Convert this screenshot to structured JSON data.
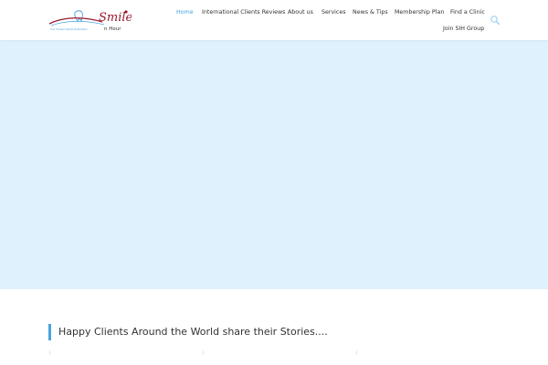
{
  "brand": {
    "logo_script": "Smile",
    "logo_sub": "n Hour",
    "logo_tagline": "Your Trusted Dental Destination"
  },
  "nav": {
    "items": [
      {
        "label": "Home",
        "active": true
      },
      {
        "label": "International Clients Reviews",
        "active": false
      },
      {
        "label": "About us",
        "active": false
      },
      {
        "label": "Services",
        "active": false
      },
      {
        "label": "News & Tips",
        "active": false
      },
      {
        "label": "Membership Plan",
        "active": false
      },
      {
        "label": "Find a Clinic",
        "active": false
      },
      {
        "label": "Join SIH Group",
        "active": false
      }
    ],
    "search_icon": "search-icon"
  },
  "hero": {
    "background": "#dff1fc"
  },
  "section": {
    "heading": "Happy Clients Around the World share their Stories...."
  },
  "colors": {
    "accent": "#4aa3df",
    "logo_red": "#9b1b30",
    "text": "#333333"
  }
}
